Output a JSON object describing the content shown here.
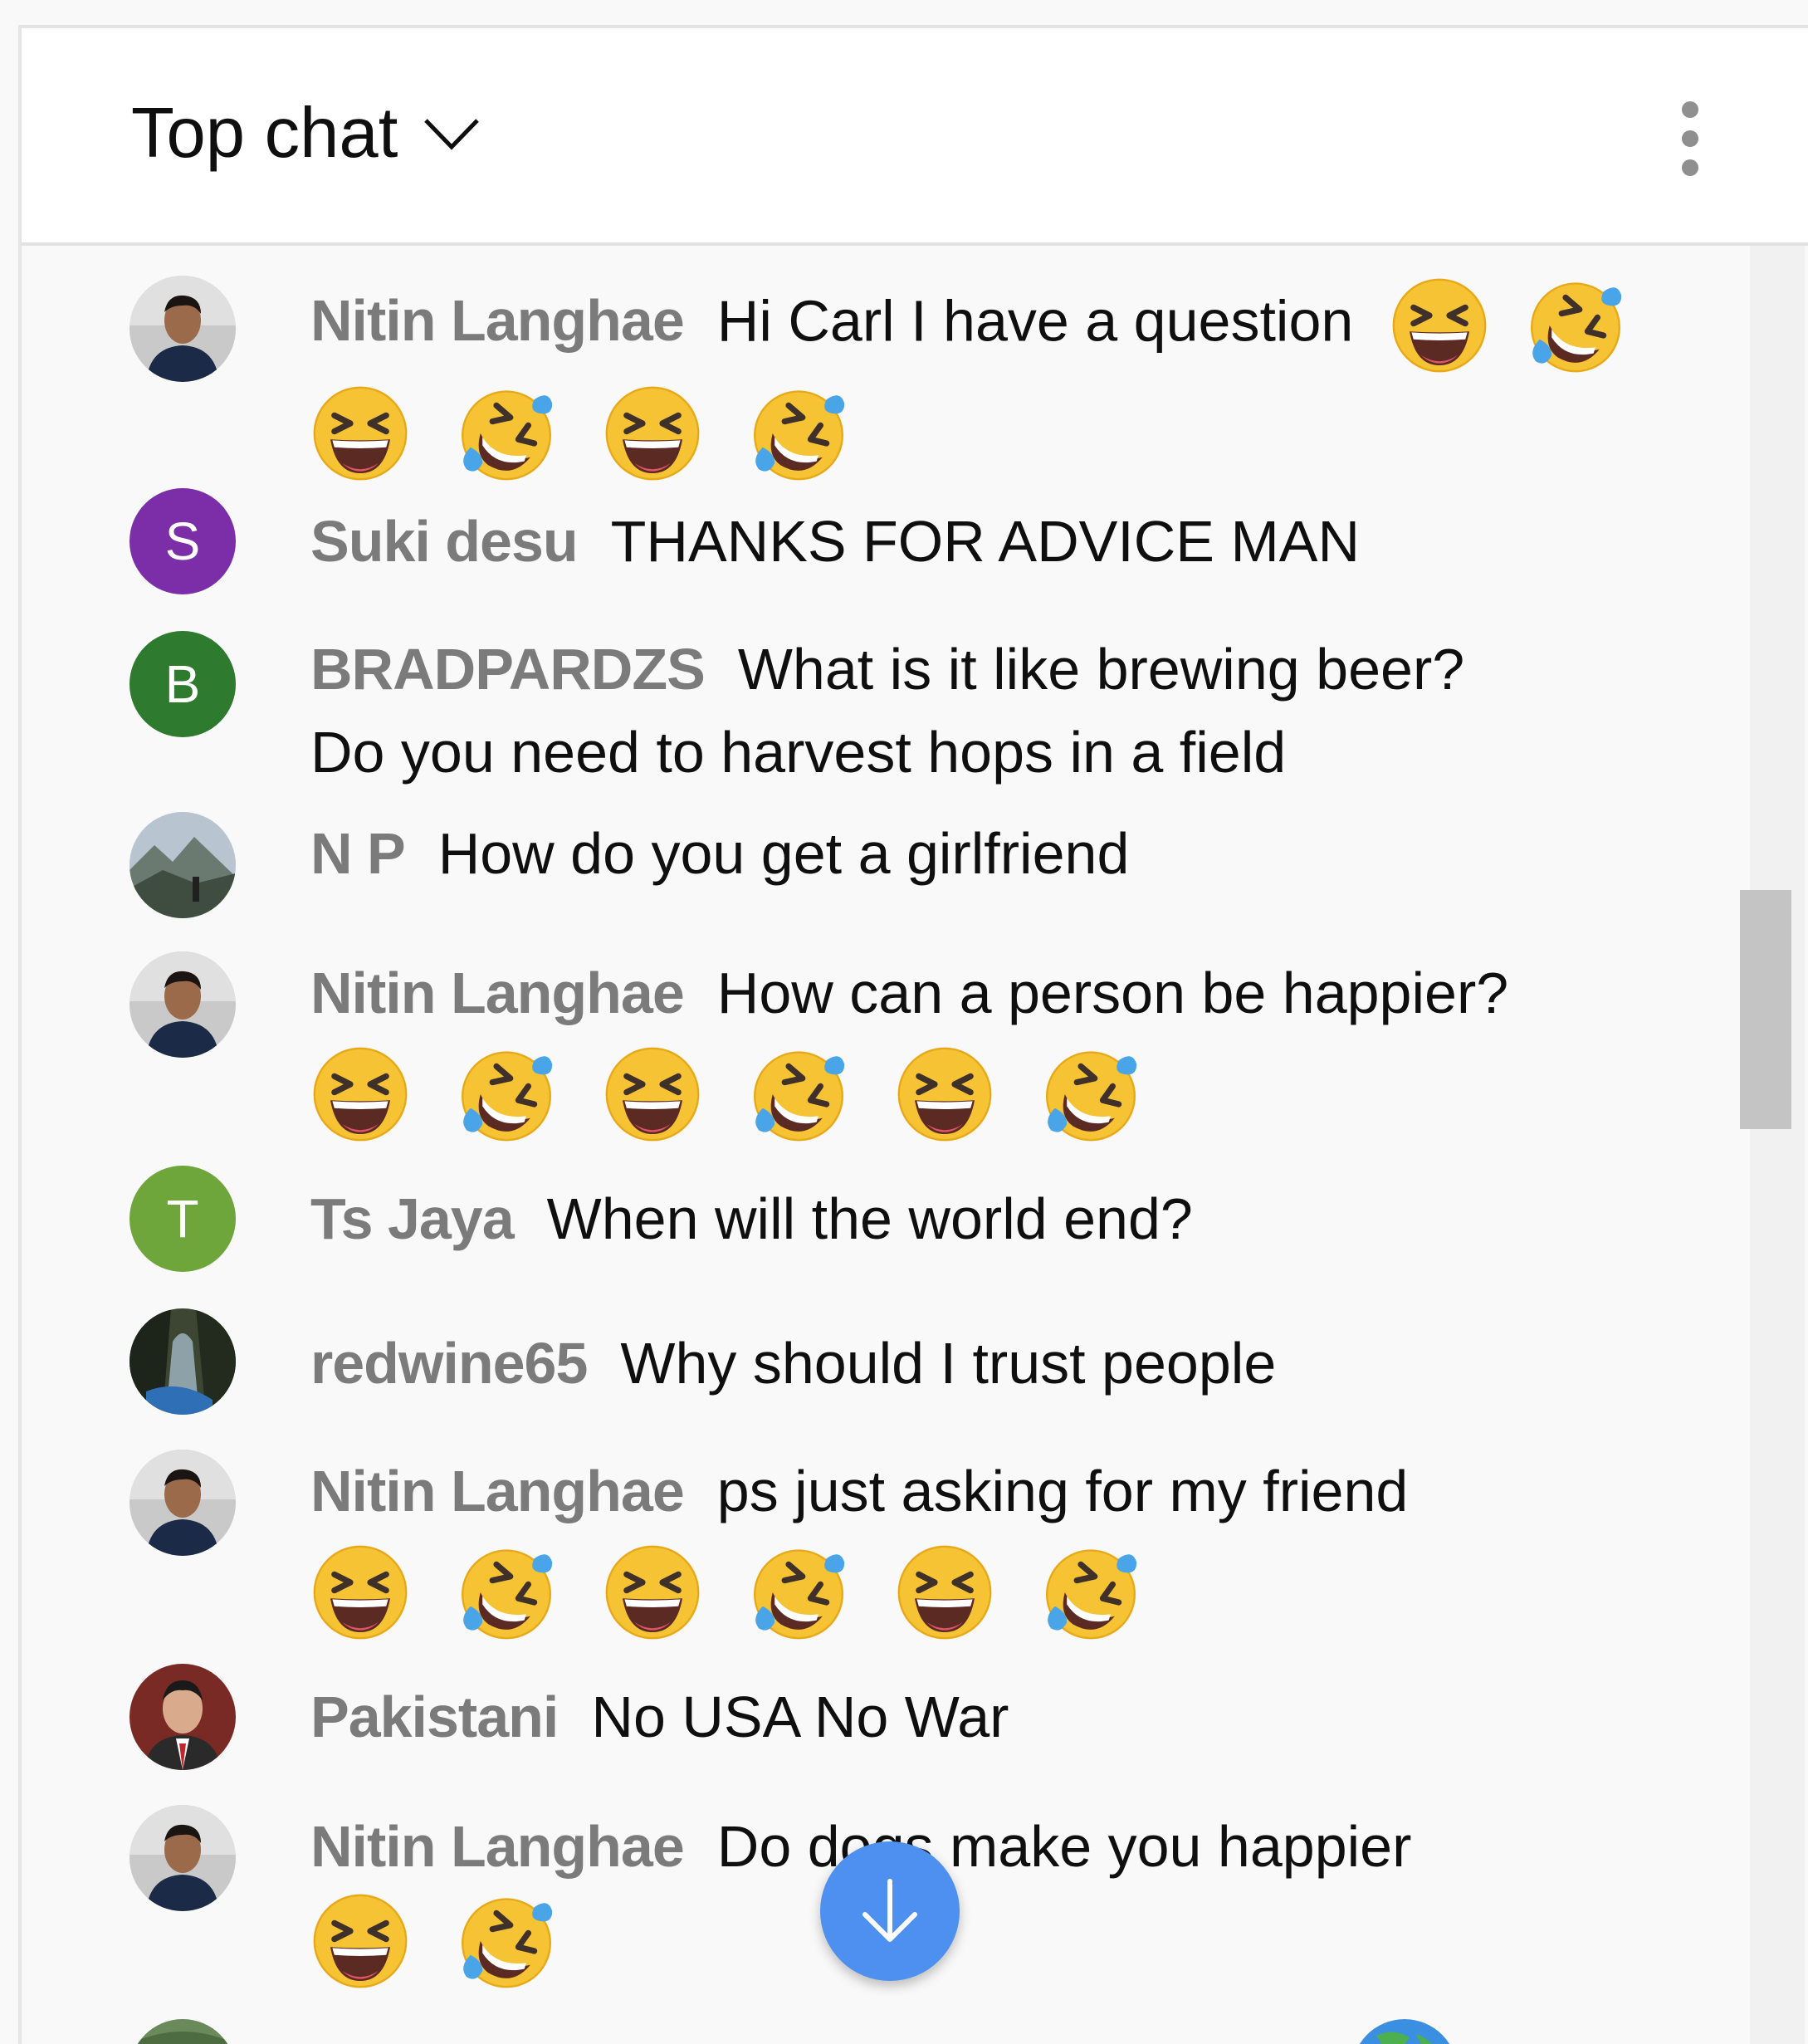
{
  "header": {
    "title": "Top chat",
    "menu_icon": "more-vertical-icon",
    "dropdown_icon": "chevron-down-icon"
  },
  "colors": {
    "author_text": "#7b7b7b",
    "message_text": "#0f0f0f",
    "fab_blue": "#4d90ef",
    "avatar_purple": "#7b2ea8",
    "avatar_green_dark": "#2e7a2f",
    "avatar_green_light": "#6ea63c",
    "emoji_yellow": "#f6c334"
  },
  "messages": [
    {
      "author": "Nitin Langhae",
      "text": "Hi Carl I have a question",
      "avatar": {
        "type": "photo",
        "name": "person-photo-avatar"
      },
      "emojis": [
        "laughing-emoji",
        "rofl-emoji",
        "laughing-emoji",
        "rofl-emoji",
        "laughing-emoji",
        "rofl-emoji"
      ]
    },
    {
      "author": "Suki desu",
      "text": "THANKS FOR ADVICE MAN",
      "avatar": {
        "type": "letter",
        "letter": "S",
        "color": "#7b2ea8"
      }
    },
    {
      "author": "BRADPARDZS",
      "text": "What is it like brewing beer? Do you need to harvest hops in a field",
      "avatar": {
        "type": "letter",
        "letter": "B",
        "color": "#2e7a2f"
      }
    },
    {
      "author": "N P",
      "text": "How do you get a girlfriend",
      "avatar": {
        "type": "photo",
        "name": "mountain-photo-avatar"
      }
    },
    {
      "author": "Nitin Langhae",
      "text": "How can a person be happier?",
      "avatar": {
        "type": "photo",
        "name": "person-photo-avatar"
      },
      "emojis": [
        "laughing-emoji",
        "rofl-emoji",
        "laughing-emoji",
        "rofl-emoji",
        "laughing-emoji",
        "rofl-emoji"
      ]
    },
    {
      "author": "Ts Jaya",
      "text": "When will the world end?",
      "avatar": {
        "type": "letter",
        "letter": "T",
        "color": "#6ea63c"
      }
    },
    {
      "author": "redwine65",
      "text": "Why should I trust people",
      "avatar": {
        "type": "photo",
        "name": "forest-photo-avatar"
      }
    },
    {
      "author": "Nitin Langhae",
      "text": "ps just asking for my friend",
      "avatar": {
        "type": "photo",
        "name": "person-photo-avatar"
      },
      "emojis": [
        "laughing-emoji",
        "rofl-emoji",
        "laughing-emoji",
        "rofl-emoji",
        "laughing-emoji",
        "rofl-emoji"
      ]
    },
    {
      "author": "Pakistani",
      "text": "No USA No War",
      "avatar": {
        "type": "photo",
        "name": "portrait-photo-avatar"
      }
    },
    {
      "author": "Nitin Langhae",
      "text": "Do dogs make you happier",
      "avatar": {
        "type": "photo",
        "name": "person-photo-avatar"
      },
      "emojis": [
        "laughing-emoji",
        "rofl-emoji"
      ]
    }
  ],
  "scroll_button": {
    "icon": "arrow-down-icon"
  }
}
